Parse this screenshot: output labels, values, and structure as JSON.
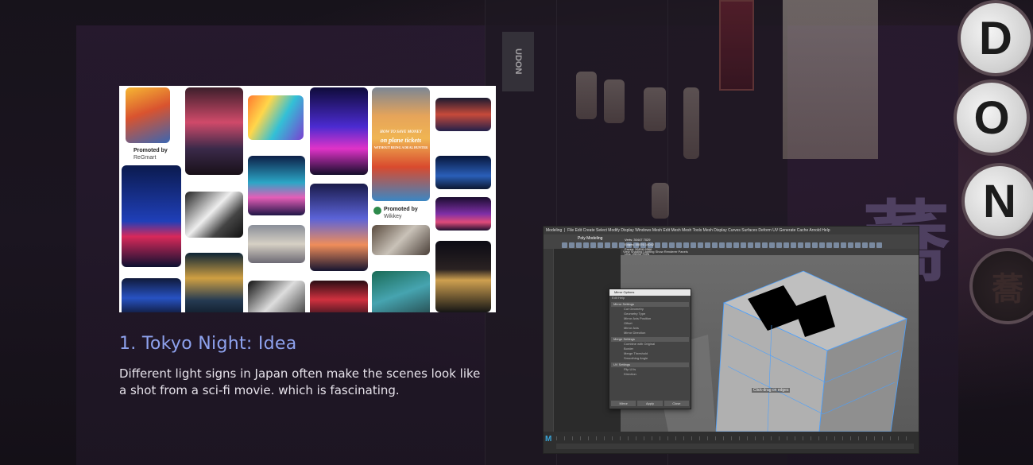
{
  "section": {
    "title": "1. Tokyo Night: Idea",
    "description": "Different light signs in Japan often make the scenes look like a shot from a sci-fi movie. which is fascinating."
  },
  "background": {
    "udon_sign": "UDON",
    "disc_letters": [
      "D",
      "O",
      "N"
    ],
    "kanji": "蕎"
  },
  "moodboard": {
    "pins": [
      {
        "kind": "product",
        "name": "pin-day-night-game"
      },
      {
        "kind": "photo",
        "name": "pin-loft-street"
      },
      {
        "kind": "photo",
        "name": "pin-rainbow-street"
      },
      {
        "kind": "photo",
        "name": "pin-purple-alley"
      },
      {
        "kind": "ad",
        "name": "pin-travel-ad"
      },
      {
        "kind": "photo",
        "name": "pin-city-night"
      }
    ],
    "promoted_1": {
      "label": "Promoted by",
      "by": "ReGmart"
    },
    "promoted_2": {
      "label": "Promoted by",
      "by": "Wikkey"
    },
    "ad_text_1": "HOW TO SAVE MONEY",
    "ad_text_2": "on plane tickets",
    "ad_text_3": "WITHOUT BEING A DEAL HUNTER"
  },
  "maya": {
    "workspace": "Modeling",
    "menu": "File  Edit  Create  Select  Modify  Display  Windows  Mesh  Edit Mesh  Mesh Tools  Mesh Display  Curves  Surfaces  Deform  UV  Generate  Cache  Arnold  Help",
    "shelf_tab": "Poly Modeling",
    "panel_menu": "View  Shading  Lighting  Show  Renderer  Panels",
    "hud_rows": [
      [
        "Verts:",
        "30447",
        "7029"
      ],
      [
        "Edges:",
        "55576",
        "14042"
      ],
      [
        "Faces:",
        "26816",
        "6966"
      ],
      [
        "UVs:",
        "29934",
        "7026"
      ]
    ],
    "dialog": {
      "title": "Mirror Options",
      "menu": "Edit  Help",
      "section_1": "Mirror Settings",
      "rows_1": [
        "Cut Geometry",
        "Geometry Type",
        "Mirror Axis Position",
        "Offset",
        "Mirror Axis",
        "Mirror Direction"
      ],
      "section_2": "Merge Settings",
      "rows_2": [
        "Combine with Original",
        "Border",
        "Merge Threshold",
        "Smoothing Angle"
      ],
      "section_3": "UV Settings",
      "rows_3": [
        "Flip UVs",
        "Direction"
      ],
      "buttons": [
        "Mirror",
        "Apply",
        "Close"
      ]
    },
    "tooltip": "Click-drag on edges",
    "logo": "M"
  }
}
